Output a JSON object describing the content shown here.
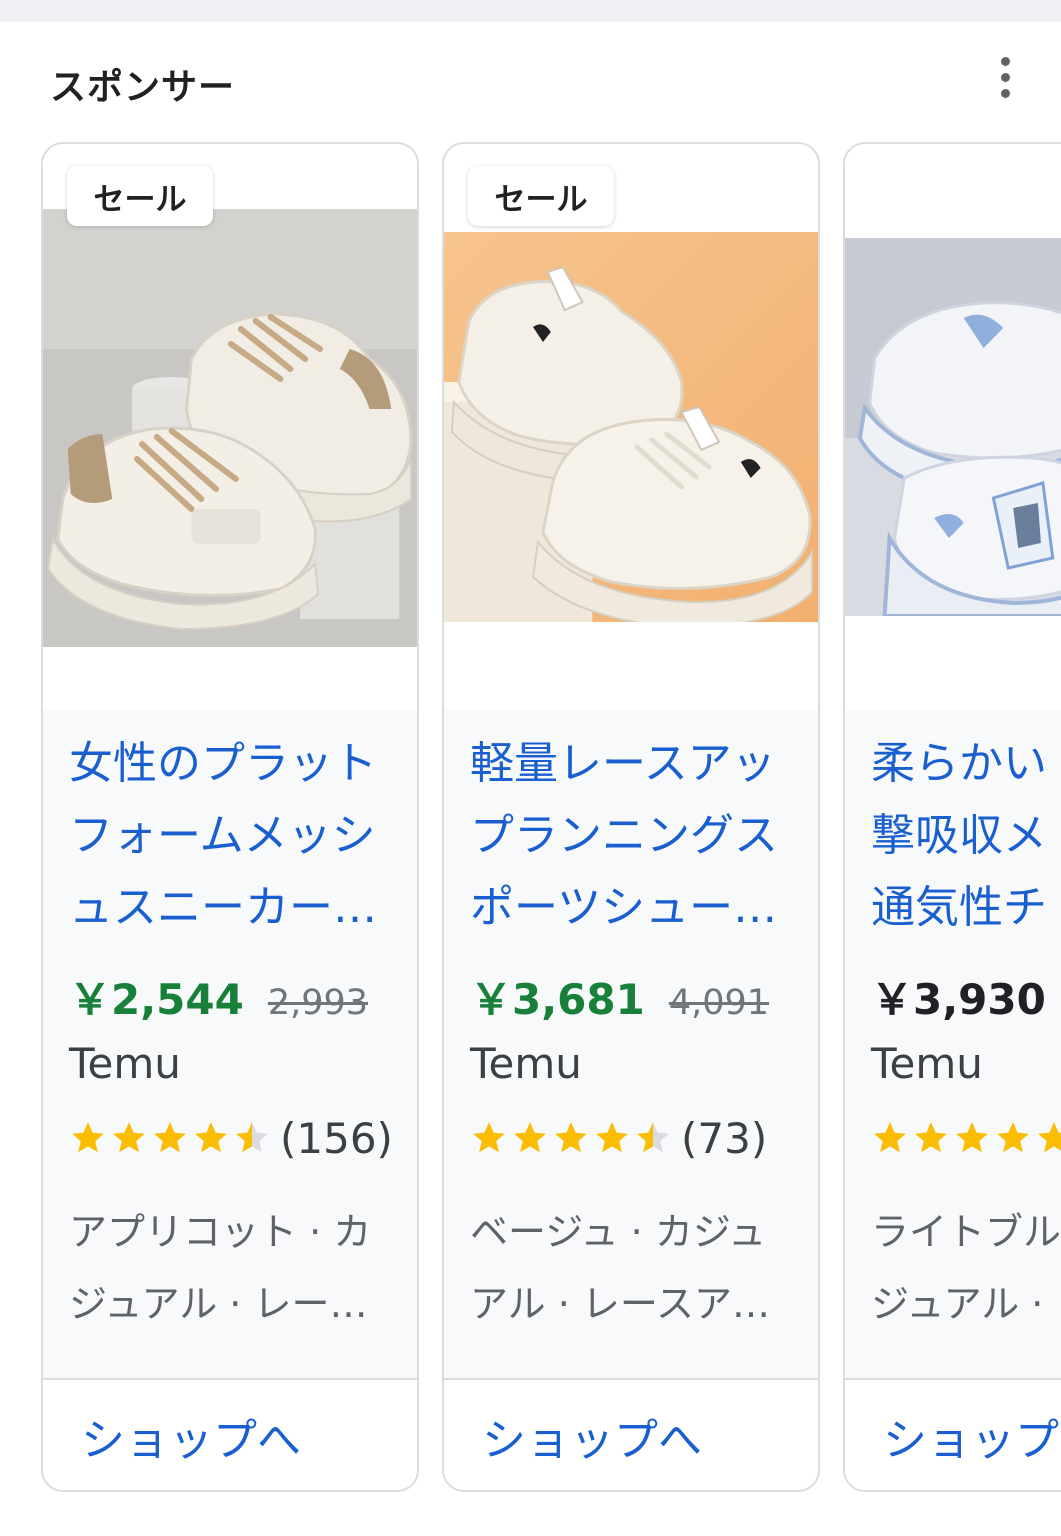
{
  "header": {
    "title": "スポンサー",
    "menu_icon": "more-vert-icon"
  },
  "products": [
    {
      "badge": "セール",
      "title": "女性のプラット\nフォームメッシ\nュスニーカー…",
      "price": "￥2,544",
      "original_price": "2,993",
      "merchant": "Temu",
      "rating": 4.5,
      "review_count": "(156)",
      "description": "アプリコット · カ\nジュアル · レー…",
      "shop_label": "ショップへ",
      "image_desc": "beige chunky platform sneakers with tan laces on grey background"
    },
    {
      "badge": "セール",
      "title": "軽量レースアッ\nプランニングス\nポーツシュー…",
      "price": "￥3,681",
      "original_price": "4,091",
      "merchant": "Temu",
      "rating": 4.5,
      "review_count": "(73)",
      "description": "ベージュ · カジュ\nアル · レースア…",
      "shop_label": "ショップへ",
      "image_desc": "cream chunky sneakers on orange background"
    },
    {
      "badge": "",
      "title": "柔らかい\n撃吸収メ\n通気性チ",
      "price": "￥3,930",
      "original_price": "",
      "merchant": "Temu",
      "rating": 5,
      "review_count": "",
      "description": "ライトブル\nジュアル ·",
      "shop_label": "ショップ",
      "image_desc": "white and light blue chunky sneakers on grey background"
    }
  ],
  "colors": {
    "link_blue": "#1a5fd0",
    "sale_green": "#188038",
    "star_yellow": "#fbbc04",
    "star_empty": "#dadce0"
  }
}
